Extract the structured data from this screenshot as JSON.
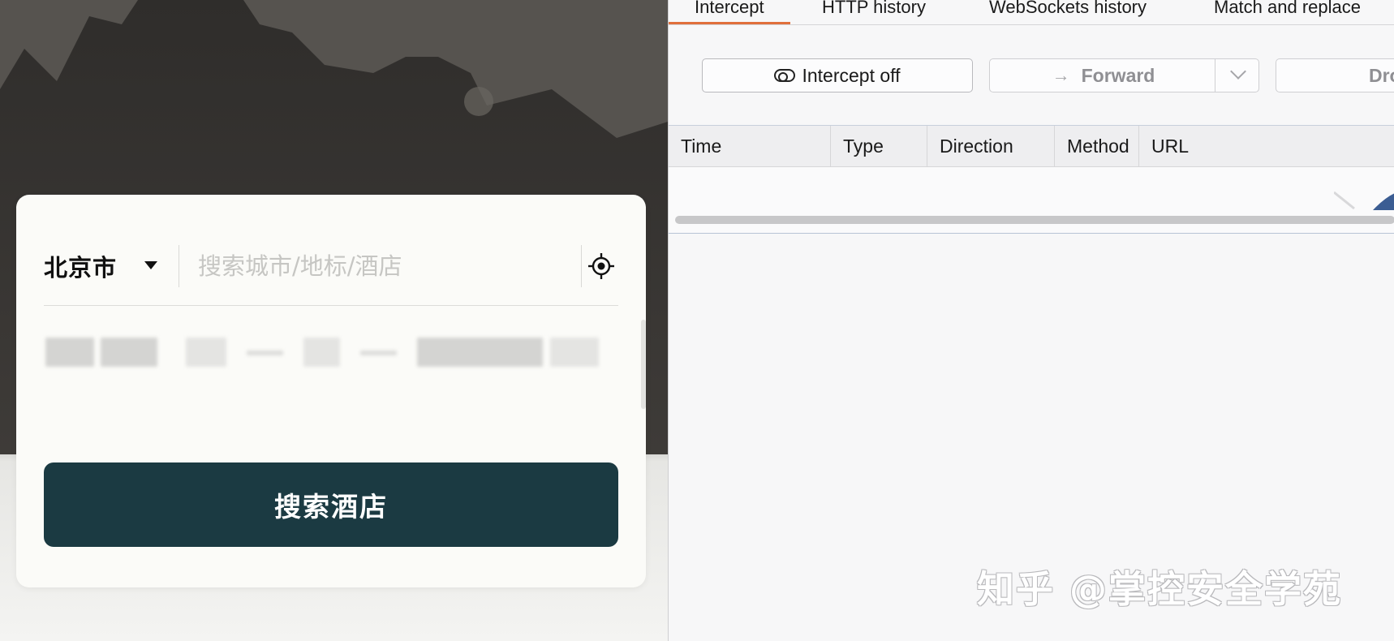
{
  "hotel_app": {
    "city": "北京市",
    "search_placeholder": "搜索城市/地标/酒店",
    "search_button": "搜索酒店"
  },
  "proxy": {
    "tabs": [
      {
        "label": "Intercept",
        "active": true
      },
      {
        "label": "HTTP history",
        "active": false
      },
      {
        "label": "WebSockets history",
        "active": false
      },
      {
        "label": "Match and replace",
        "active": false
      }
    ],
    "toolbar": {
      "intercept_label": "Intercept off",
      "forward_label": "Forward",
      "drop_label": "Drop"
    },
    "columns": [
      "Time",
      "Type",
      "Direction",
      "Method",
      "URL"
    ]
  },
  "watermark": "知乎 @掌控安全学苑",
  "colors": {
    "search_button_bg": "#1b3a42",
    "active_tab_accent": "#e0703c"
  }
}
